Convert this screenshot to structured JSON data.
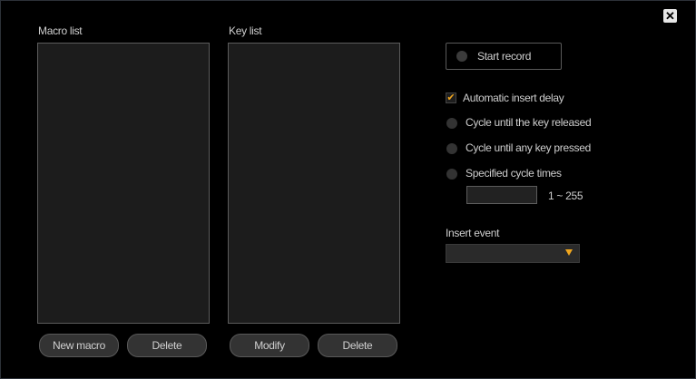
{
  "window": {
    "close_label": "✕"
  },
  "macro_list": {
    "title": "Macro list",
    "items": []
  },
  "key_list": {
    "title": "Key list",
    "items": []
  },
  "buttons": {
    "new_macro": "New macro",
    "delete_macro": "Delete",
    "modify": "Modify",
    "delete_key": "Delete"
  },
  "record": {
    "label": "Start record"
  },
  "options": {
    "auto_insert_delay": {
      "label": "Automatic insert delay",
      "checked": true
    },
    "cycle_until_released": {
      "label": "Cycle until the key released",
      "selected": false
    },
    "cycle_until_any_key": {
      "label": "Cycle until any key pressed",
      "selected": false
    },
    "specified_cycle_times": {
      "label": "Specified cycle times",
      "selected": false
    }
  },
  "cycle_times": {
    "value": "",
    "range_label": "1 ~ 255"
  },
  "insert_event": {
    "label": "Insert event",
    "value": ""
  },
  "icons": {
    "check": "✔",
    "close": "close-icon",
    "dropdown": "chevron-down-icon"
  },
  "colors": {
    "accent": "#f0a61e",
    "background": "#000000",
    "panel": "#1c1c1c"
  }
}
